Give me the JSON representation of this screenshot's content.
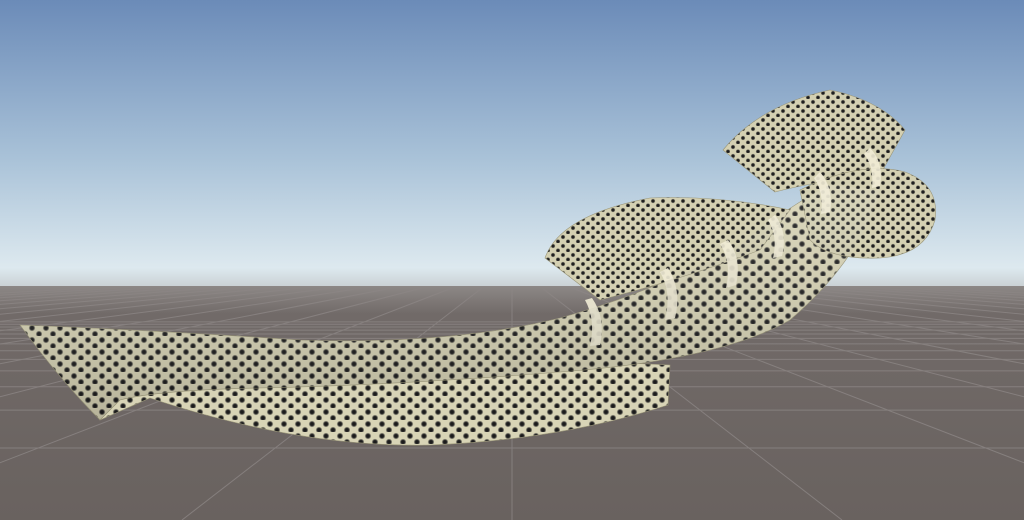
{
  "scene": {
    "colors": {
      "sky_top": "#6b8bb8",
      "sky_horizon": "#dbe8ef",
      "ground": "#6b6462",
      "grid_line": "#8a8483",
      "mesh_base": "#d6d2b4",
      "mesh_spot": "#1e1e1e",
      "wire": "#9a9678"
    },
    "objects": [
      {
        "name": "spotted-creature-mesh"
      }
    ]
  }
}
